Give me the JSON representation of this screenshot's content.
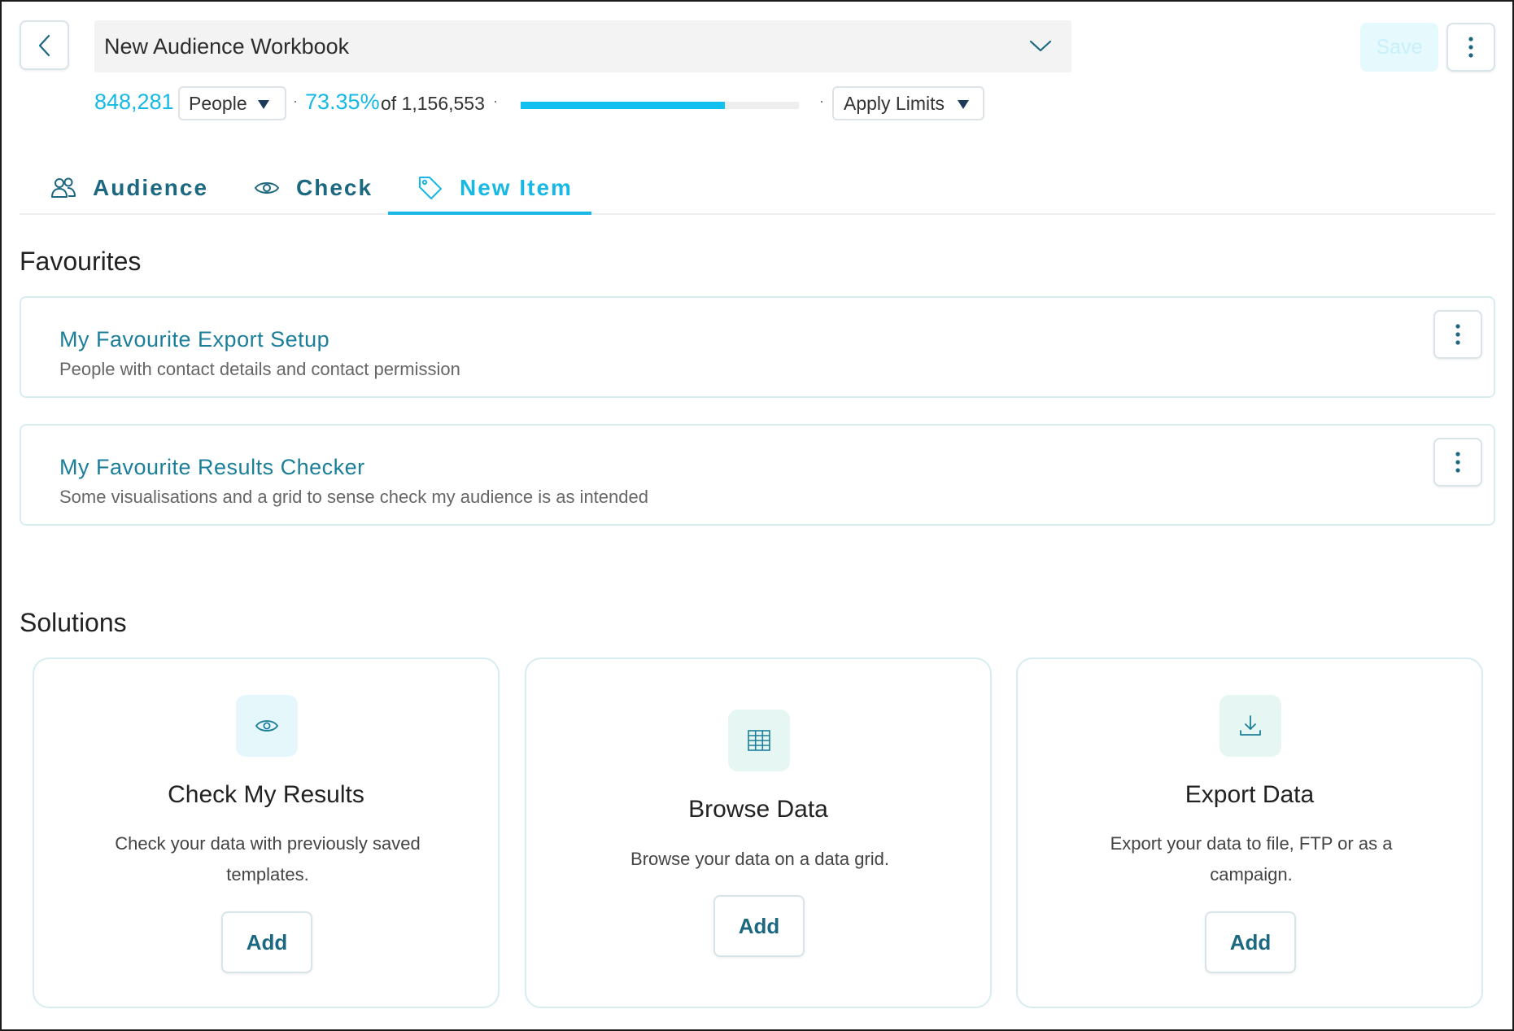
{
  "header": {
    "title": "New Audience Workbook",
    "save_label": "Save"
  },
  "stats": {
    "count": "848,281",
    "unit": "People",
    "percent": "73.35%",
    "of_total": "of 1,156,553",
    "progress_fraction": 0.7335,
    "limits_label": "Apply Limits"
  },
  "tabs": [
    {
      "label": "Audience",
      "icon": "people-icon"
    },
    {
      "label": "Check",
      "icon": "eye-icon"
    },
    {
      "label": "New Item",
      "icon": "tag-icon",
      "active": true
    }
  ],
  "favourites": {
    "heading": "Favourites",
    "items": [
      {
        "title": "My Favourite Export Setup",
        "description": "People with contact details and contact permission"
      },
      {
        "title": "My Favourite Results Checker",
        "description": "Some visualisations and a grid to sense check my audience is as intended"
      }
    ]
  },
  "solutions": {
    "heading": "Solutions",
    "items": [
      {
        "title": "Check My Results",
        "description": "Check your data with previously saved templates.",
        "button": "Add",
        "icon": "eye-icon"
      },
      {
        "title": "Browse Data",
        "description": "Browse your data on a data grid.",
        "button": "Add",
        "icon": "grid-icon"
      },
      {
        "title": "Export Data",
        "description": "Export your data to file, FTP or as a campaign.",
        "button": "Add",
        "icon": "download-icon"
      }
    ]
  },
  "colors": {
    "accent": "#18b8e5",
    "teal_text": "#1c6880",
    "link": "#1c7f9a"
  }
}
